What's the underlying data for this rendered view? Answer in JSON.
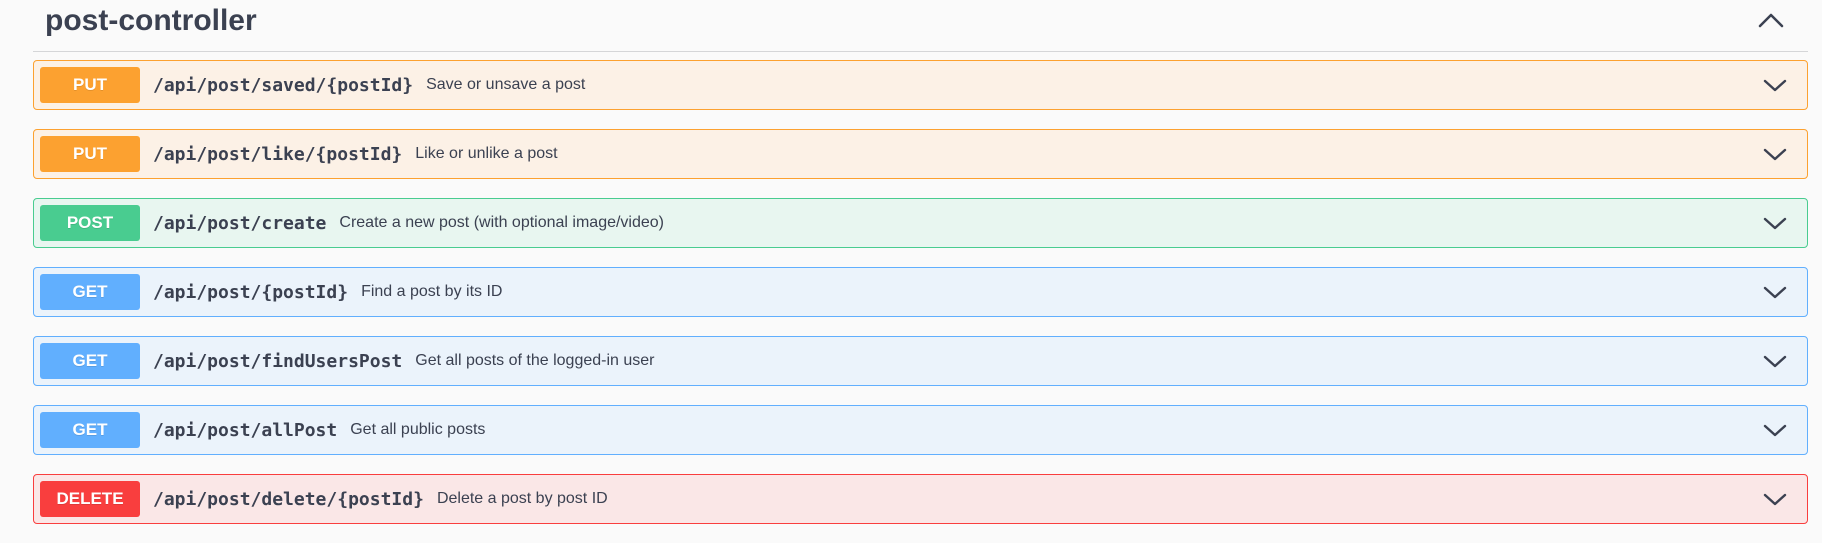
{
  "section": {
    "title": "post-controller",
    "toggle_icon": "chevron-up-icon"
  },
  "operations": [
    {
      "method": "PUT",
      "path": "/api/post/saved/{postId}",
      "summary": "Save or unsave a post",
      "kind": "put",
      "icon": "chevron-down-icon"
    },
    {
      "method": "PUT",
      "path": "/api/post/like/{postId}",
      "summary": "Like or unlike a post",
      "kind": "put",
      "icon": "chevron-down-icon"
    },
    {
      "method": "POST",
      "path": "/api/post/create",
      "summary": "Create a new post (with optional image/video)",
      "kind": "post",
      "icon": "chevron-down-icon"
    },
    {
      "method": "GET",
      "path": "/api/post/{postId}",
      "summary": "Find a post by its ID",
      "kind": "get",
      "icon": "chevron-down-icon"
    },
    {
      "method": "GET",
      "path": "/api/post/findUsersPost",
      "summary": "Get all posts of the logged-in user",
      "kind": "get",
      "icon": "chevron-down-icon"
    },
    {
      "method": "GET",
      "path": "/api/post/allPost",
      "summary": "Get all public posts",
      "kind": "get",
      "icon": "chevron-down-icon"
    },
    {
      "method": "DELETE",
      "path": "/api/post/delete/{postId}",
      "summary": "Delete a post by post ID",
      "kind": "delete",
      "icon": "chevron-down-icon"
    }
  ],
  "colors": {
    "put": "#fca130",
    "post": "#49cc90",
    "get": "#61affe",
    "delete": "#f93e3e",
    "text": "#3b4151"
  }
}
